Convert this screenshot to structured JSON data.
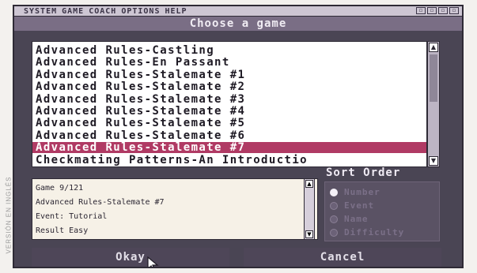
{
  "side_caption": "VERSIÓN EN INGLÉS",
  "menubar": {
    "items": [
      "SYSTEM",
      "GAME",
      "COACH",
      "OPTIONS",
      "HELP"
    ],
    "window_buttons": [
      "▫",
      "▫",
      "▫",
      "▫"
    ]
  },
  "dialog": {
    "title": "Choose a game",
    "games": [
      "Advanced Rules-Castling",
      "Advanced Rules-En Passant",
      "Advanced Rules-Stalemate #1",
      "Advanced Rules-Stalemate #2",
      "Advanced Rules-Stalemate #3",
      "Advanced Rules-Stalemate #4",
      "Advanced Rules-Stalemate #5",
      "Advanced Rules-Stalemate #6",
      "Advanced Rules-Stalemate #7",
      "Checkmating Patterns-An Introductio"
    ],
    "selected_index": 8,
    "info": {
      "game": "Game 9/121",
      "name": "Advanced Rules-Stalemate #7",
      "event": "Event: Tutorial",
      "result": "Result Easy"
    },
    "sort_order": {
      "label": "Sort Order",
      "options": [
        "Number",
        "Event",
        "Name",
        "Difficulty"
      ],
      "selected_index": 0
    },
    "buttons": {
      "okay": "Okay",
      "cancel": "Cancel"
    }
  },
  "colors": {
    "selection": "#b03a64",
    "background": "#4a4554"
  }
}
